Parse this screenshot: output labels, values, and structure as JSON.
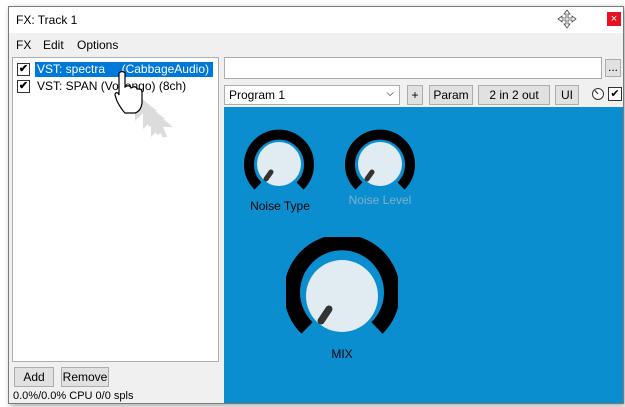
{
  "window": {
    "title": "FX: Track 1",
    "close_glyph": "×"
  },
  "menu": {
    "items": [
      "FX",
      "Edit",
      "Options"
    ]
  },
  "fx_chain": {
    "items": [
      {
        "label": "VST: spectra",
        "vendor": "(CabbageAudio)",
        "enabled": true,
        "selected": true
      },
      {
        "label": "VST: SPAN (Voxengo) (8ch)",
        "enabled": true,
        "selected": false
      }
    ]
  },
  "buttons": {
    "add": "Add",
    "remove": "Remove",
    "dots": "...",
    "plus": "+",
    "param": "Param",
    "io": "2 in 2 out",
    "ui": "UI"
  },
  "status": {
    "cpu": "0.0%/0.0% CPU 0/0 spls"
  },
  "preset": {
    "selected": "Program 1",
    "arrow": "⌵"
  },
  "plugin": {
    "background": "#0a8ed0",
    "knobs": [
      {
        "label": "Noise Type",
        "label_color": "#000000"
      },
      {
        "label": "Noise Level",
        "label_color": "#7fb0cc"
      },
      {
        "label": "MIX",
        "label_color": "#000000"
      }
    ]
  },
  "icons": {
    "checkbox": "checkmark-icon",
    "cursor": "hand-pointer-icon",
    "move": "move-cursor-icon"
  }
}
